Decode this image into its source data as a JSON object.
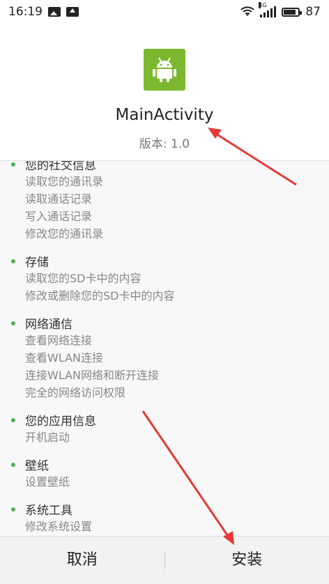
{
  "status_bar": {
    "time": "16:19",
    "network_type": "4G",
    "battery_level": "87",
    "battery_fraction": 0.87
  },
  "app": {
    "name": "MainActivity",
    "version": "版本: 1.0",
    "icon_color": "#7cb82f"
  },
  "permissions": [
    {
      "title": "您的社交信息",
      "items": [
        "读取您的通讯录",
        "读取通话记录",
        "写入通话记录",
        "修改您的通讯录"
      ]
    },
    {
      "title": "存储",
      "items": [
        "读取您的SD卡中的内容",
        "修改或删除您的SD卡中的内容"
      ]
    },
    {
      "title": "网络通信",
      "items": [
        "查看网络连接",
        "查看WLAN连接",
        "连接WLAN网络和断开连接",
        "完全的网络访问权限"
      ]
    },
    {
      "title": "您的应用信息",
      "items": [
        "开机启动"
      ]
    },
    {
      "title": "壁纸",
      "items": [
        "设置壁纸"
      ]
    },
    {
      "title": "系统工具",
      "items": [
        "修改系统设置"
      ]
    }
  ],
  "actions": {
    "cancel_label": "取消",
    "install_label": "安装"
  },
  "colors": {
    "bullet": "#4caf50",
    "annotation_arrow": "#e53935"
  }
}
